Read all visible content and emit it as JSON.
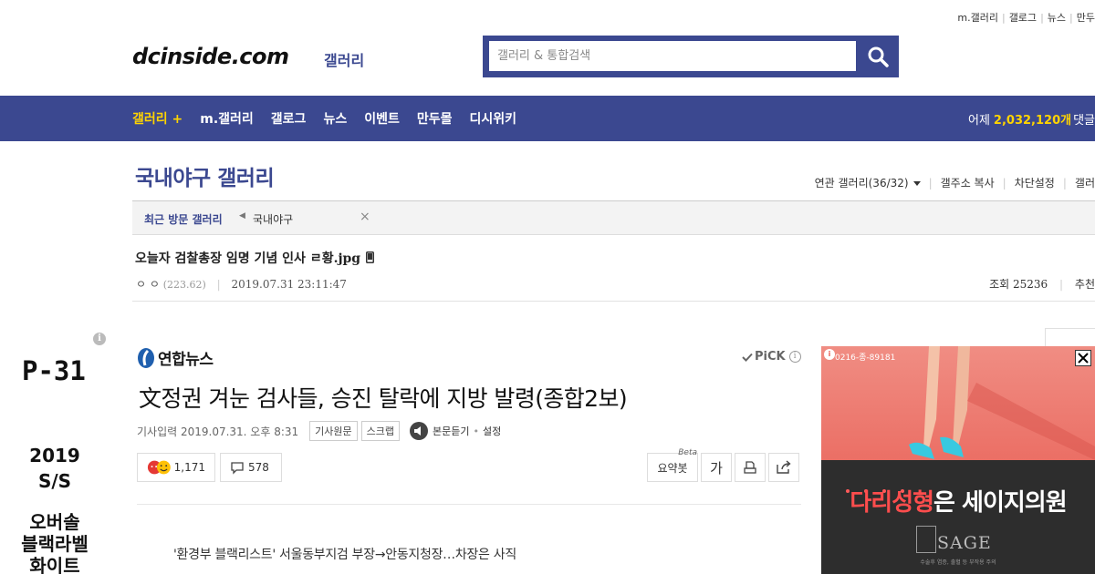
{
  "util_links": [
    "m.갤러리",
    "갤로그",
    "뉴스",
    "만두"
  ],
  "header": {
    "logo": "dcinside.com",
    "logo_sub": "갤러리",
    "search_placeholder": "갤러리 & 통합검색"
  },
  "nav": {
    "items": [
      {
        "label": "갤러리 +",
        "active": true
      },
      {
        "label": "m.갤러리",
        "active": false
      },
      {
        "label": "갤로그",
        "active": false
      },
      {
        "label": "뉴스",
        "active": false
      },
      {
        "label": "이벤트",
        "active": false
      },
      {
        "label": "만두몰",
        "active": false
      },
      {
        "label": "디시위키",
        "active": false
      }
    ],
    "stat_prefix": "어제",
    "stat_count": "2,032,120개",
    "stat_suffix": "댓글"
  },
  "gallery": {
    "title": "국내야구 갤러리",
    "related": "연관 갤러리(36/32)",
    "copy_address": "갤주소 복사",
    "block_settings": "차단설정",
    "more": "갤러"
  },
  "recent": {
    "label": "최근 방문 갤러리",
    "item": "국내야구",
    "close": "×"
  },
  "post": {
    "title": "오늘자 검찰총장 임명 기념 인사 ㄹ황.jpg",
    "author": "ㅇ ㅇ",
    "ip": "(223.62)",
    "date": "2019.07.31 23:11:47",
    "views_label": "조회 25236",
    "recommend_label": "추천"
  },
  "left_ad": {
    "info": "i",
    "brand": "P-31",
    "season_year": "2019",
    "season": "S/S",
    "lines": [
      "오버솔",
      "블랙라벨",
      "화이트"
    ]
  },
  "article": {
    "source": "연합뉴스",
    "pick": "PiCK",
    "pick_info": "i",
    "headline": "文정권 겨눈 검사들, 승진 탈락에 지방 발령(종합2보)",
    "published": "기사입력 2019.07.31. 오후 8:31",
    "original_button": "기사원문",
    "scrap_button": "스크랩",
    "listen_label": "본문듣기",
    "settings_label": "설정",
    "reaction_count": "1,171",
    "comment_count": "578",
    "summary_button": "요약봇",
    "summary_beta": "Beta",
    "font_button": "가",
    "subhead": "'환경부 블랙리스트' 서울동부지검 부장→안동지청장…차장은 사직"
  },
  "right_ad": {
    "badge": "i",
    "phone": "0216-종-89181",
    "headline_red": "다리성형",
    "headline_rest": "은 세이지의원",
    "brand": "SAGE",
    "small_print": "수술후 염증, 출혈 등 부작용 주의"
  },
  "colors": {
    "brand_blue": "#3b4890",
    "nav_active": "#ffd400",
    "ad_red": "#e8645a"
  }
}
